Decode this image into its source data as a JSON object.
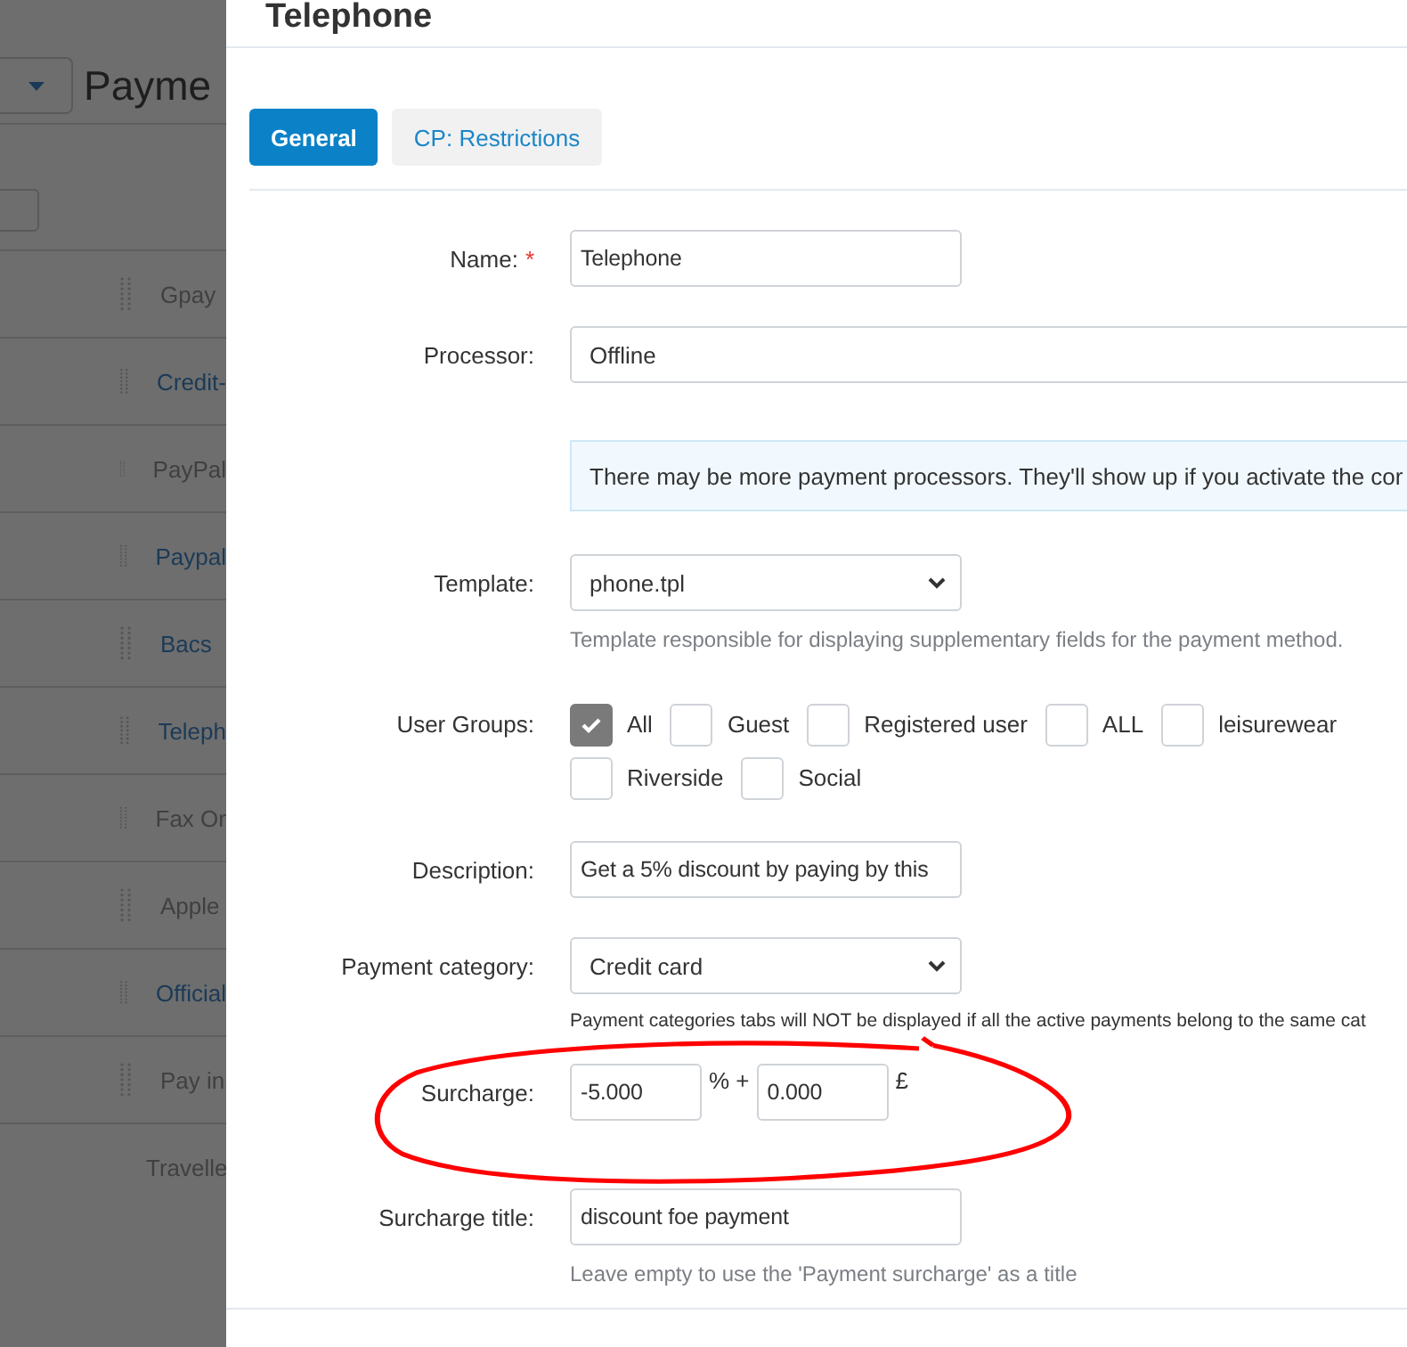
{
  "background_page": {
    "heading": "Payme",
    "select_all": {
      "checked": false
    },
    "rows": [
      {
        "label": "Gpay",
        "active": false
      },
      {
        "label": "Credit-",
        "active": true
      },
      {
        "label": "PayPal",
        "active": false
      },
      {
        "label": "Paypal",
        "active": true
      },
      {
        "label": "Bacs",
        "active": true
      },
      {
        "label": "Teleph",
        "active": true
      },
      {
        "label": "Fax Or",
        "active": false
      },
      {
        "label": "Apple",
        "active": false
      },
      {
        "label": "Official",
        "active": true
      },
      {
        "label": "Pay in",
        "active": false
      },
      {
        "label": "Travelle",
        "active": false
      }
    ]
  },
  "dialog": {
    "title": "Telephone",
    "tabs": [
      {
        "label": "General",
        "selected": true
      },
      {
        "label": "CP: Restrictions",
        "selected": false
      }
    ],
    "form": {
      "name": {
        "label": "Name:",
        "required_mark": "*",
        "value": "Telephone"
      },
      "processor": {
        "label": "Processor:",
        "value": "Offline"
      },
      "info": "There may be more payment processors. They'll show up if you activate the cor",
      "template": {
        "label": "Template:",
        "value": "phone.tpl",
        "hint": "Template responsible for displaying supplementary fields for the payment method."
      },
      "user_groups": {
        "label": "User Groups:",
        "items": [
          {
            "label": "All",
            "checked": true
          },
          {
            "label": "Guest",
            "checked": false
          },
          {
            "label": "Registered user",
            "checked": false
          },
          {
            "label": "ALL",
            "checked": false
          },
          {
            "label": "leisurewear",
            "checked": false
          },
          {
            "label": "Riverside",
            "checked": false
          },
          {
            "label": "Social",
            "checked": false
          }
        ]
      },
      "description": {
        "label": "Description:",
        "value": "Get a 5% discount by paying by this"
      },
      "payment_category": {
        "label": "Payment category:",
        "value": "Credit card",
        "note": "Payment categories tabs will NOT be displayed if all the active payments belong to the same cat"
      },
      "surcharge": {
        "label": "Surcharge:",
        "percent": "-5.000",
        "percent_unit": "% +",
        "amount": "0.000",
        "currency": "£"
      },
      "surcharge_title": {
        "label": "Surcharge title:",
        "value": "discount foe payment",
        "hint": "Leave empty to use the 'Payment surcharge' as a title"
      }
    }
  }
}
